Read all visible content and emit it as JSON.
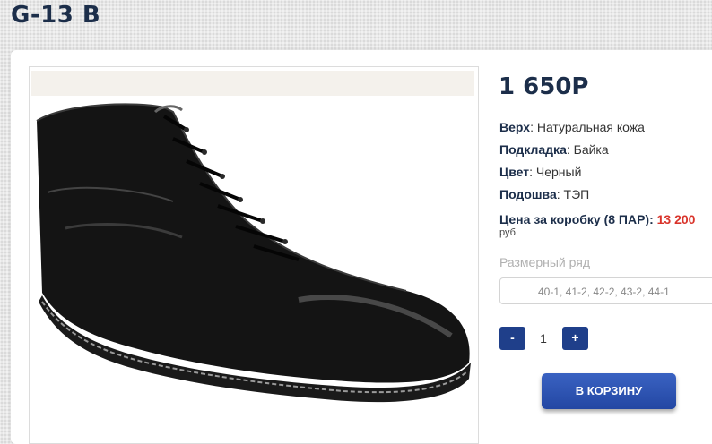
{
  "product": {
    "title": "G-13 B",
    "price": "1 650Р",
    "image_icon": "black-leather-lace-up-boot-photo"
  },
  "attributes": [
    {
      "key": "Верх",
      "value": ": Натуральная кожа"
    },
    {
      "key": "Подкладка",
      "value": ": Байка"
    },
    {
      "key": "Цвет",
      "value": ": Черный"
    },
    {
      "key": "Подошва",
      "value": ": ТЭП"
    }
  ],
  "box_price": {
    "label": "Цена за коробку (8 ПАР): ",
    "value": "13 200",
    "currency": "руб"
  },
  "sizes": {
    "label": "Размерный ряд",
    "selected": "40-1, 41-2, 42-2, 43-2, 44-1"
  },
  "quantity": {
    "minus_label": "-",
    "value": "1",
    "plus_label": "+"
  },
  "cart": {
    "button_label": "В КОРЗИНУ"
  },
  "colors": {
    "brand_dark": "#1c2e4a",
    "button_blue": "#2347a3",
    "price_red": "#d9342b"
  }
}
